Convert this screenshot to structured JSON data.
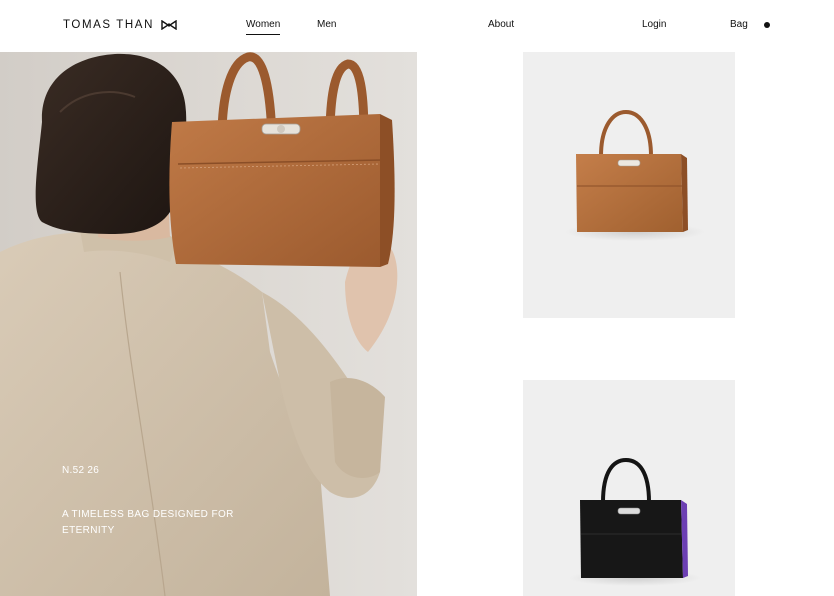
{
  "header": {
    "brand": "TOMAS THAN",
    "brand_icon": "bowtie-logo-icon",
    "nav": {
      "women": "Women",
      "men": "Men",
      "about": "About",
      "login": "Login",
      "bag": "Bag"
    },
    "active_nav": "Women"
  },
  "hero": {
    "code": "N.52 26",
    "tagline": "A TIMELESS BAG DESIGNED FOR ETERNITY",
    "image": "model-holding-tan-bag"
  },
  "products": [
    {
      "image": "tan-leather-tote",
      "color": "#b46a3a"
    },
    {
      "image": "black-leather-tote",
      "color": "#141414"
    }
  ],
  "colors": {
    "background": "#ffffff",
    "card_background": "#efefef",
    "text": "#111111",
    "tan_leather": "#b46a3a"
  }
}
